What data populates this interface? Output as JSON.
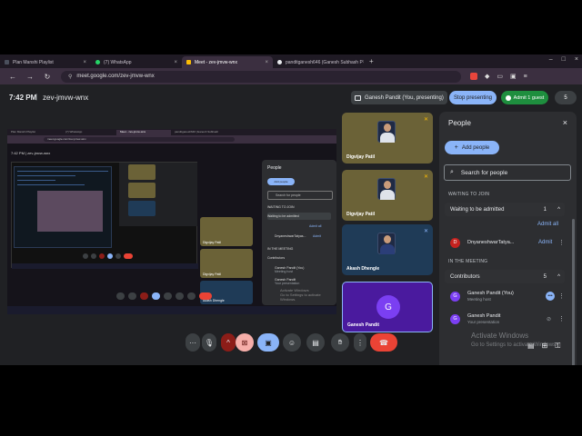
{
  "browser": {
    "tabs": [
      {
        "label": "Plan Manshi Playlist",
        "color": "#4a4f5c",
        "active": false
      },
      {
        "label": "(7) WhatsApp",
        "color": "#25d366",
        "active": false
      },
      {
        "label": "Meet - zev-jmvw-wnx",
        "color": "#fbbc04",
        "active": true
      },
      {
        "label": "panditganesh646 (Ganesh Subhash P",
        "color": "#e8eaed",
        "active": false
      }
    ],
    "url": "meet.google.com/zev-jmvw-wnx"
  },
  "meet": {
    "time": "7:42 PM",
    "separator": "|",
    "code": "zev-jmvw-wnx",
    "presenting_label": "Ganesh Pandit (You, presenting)",
    "stop_label": "Stop presenting",
    "admit_label": "Admit 1 guest",
    "people_count": "5"
  },
  "presented": {
    "tabs": [
      "Plan Manshi Playlist",
      "(7) WhatsApp",
      "Meet - zev-jmvw-wnx",
      "panditganesh646 (Ganesh Subhash"
    ],
    "url": "meet.google.com/zev-jmvw-wnx",
    "time": "7:42 PM  |  zev-jmvw-wnx",
    "tiles": [
      "Digvijay Patil",
      "Digvijay Patil",
      "Akash Dhengle",
      "Ganesh Pandit"
    ],
    "avatar_letter": "G",
    "panel": {
      "title": "People",
      "add": "Add people",
      "search": "Search for people",
      "waiting_section": "WAITING TO JOIN",
      "waiting_group": "Waiting to be admitted",
      "admit_all": "Admit all",
      "waiting_person": "DnyaneshwarTatyas...",
      "admit": "Admit",
      "in_meeting": "IN THE MEETING",
      "contributors": "Contributors",
      "person1": "Ganesh Pandit (You)",
      "person1_sub": "Meeting host",
      "person2": "Ganesh Pandit",
      "person2_sub": "Your presentation"
    },
    "watermark1": "Activate Windows",
    "watermark2": "Go to Settings to activate Windows."
  },
  "tiles": [
    {
      "name": "Digvijay Patil",
      "bg": "#6b6237",
      "type": "photo"
    },
    {
      "name": "Digvijay Patil",
      "bg": "#6b6237",
      "type": "photo"
    },
    {
      "name": "Akash Dhengle",
      "bg": "#1f3b57",
      "type": "photo"
    },
    {
      "name": "Ganesh Pandit",
      "bg": "#4a1a9e",
      "type": "avatar",
      "letter": "G"
    }
  ],
  "panel": {
    "title": "People",
    "add_people": "Add people",
    "search_placeholder": "Search for people",
    "waiting_section": "WAITING TO JOIN",
    "waiting_group": "Waiting to be admitted",
    "waiting_count": "1",
    "admit_all": "Admit all",
    "waiting_person": {
      "initial": "D",
      "name": "DnyaneshwarTatya...",
      "action": "Admit",
      "color": "#c5221f"
    },
    "in_meeting_section": "IN THE MEETING",
    "contributors_label": "Contributors",
    "contributors_count": "5",
    "members": [
      {
        "initial": "G",
        "name": "Ganesh Pandit (You)",
        "sub": "Meeting host",
        "color": "#7b3ff2"
      },
      {
        "initial": "G",
        "name": "Ganesh Pandit",
        "sub": "Your presentation",
        "color": "#7b3ff2"
      }
    ]
  },
  "windows_watermark": {
    "line1": "Activate Windows",
    "line2": "Go to Settings to activate Windows."
  }
}
